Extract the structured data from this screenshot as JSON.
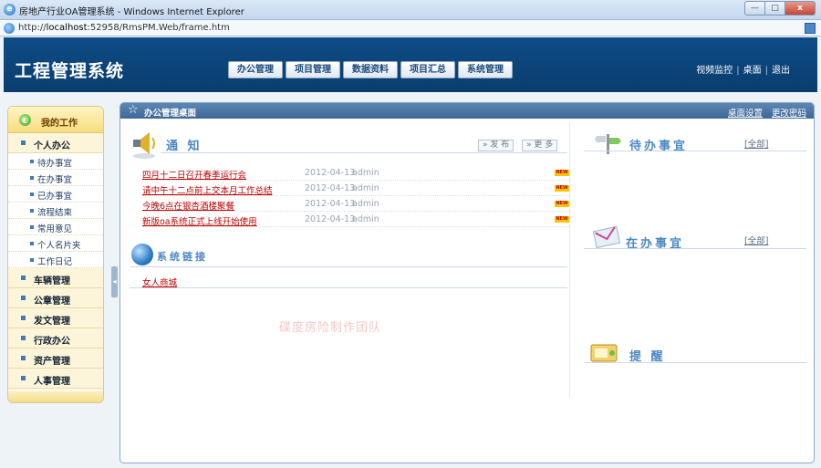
{
  "browser": {
    "window_title": "房地产行业OA管理系统 - Windows Internet Explorer",
    "url_prefix": "http://",
    "url_host": "localhost",
    "url_rest": ":52958/RmsPM.Web/frame.htm",
    "min_label": "—",
    "max_label": "□",
    "close_label": "x"
  },
  "header": {
    "logo": "工程管理系统",
    "nav": [
      "办公管理",
      "项目管理",
      "数据资料",
      "项目汇总",
      "系统管理"
    ],
    "links": [
      "视频监控",
      "桌面",
      "退出"
    ],
    "separator": "|"
  },
  "sidebar": {
    "title": "我的工作",
    "groups": [
      {
        "label": "个人办公",
        "items": [
          "待办事宜",
          "在办事宜",
          "已办事宜",
          "流程结束",
          "常用意见",
          "个人名片夹",
          "工作日记"
        ]
      },
      {
        "label": "车辆管理",
        "items": []
      },
      {
        "label": "公章管理",
        "items": []
      },
      {
        "label": "发文管理",
        "items": []
      },
      {
        "label": "行政办公",
        "items": []
      },
      {
        "label": "资产管理",
        "items": []
      },
      {
        "label": "人事管理",
        "items": []
      }
    ],
    "collapse_glyph": "◂"
  },
  "main": {
    "title": "办公管理桌面",
    "links": [
      "桌面设置",
      "更改密码"
    ],
    "notice": {
      "title": "通 知",
      "buttons": [
        "» 发 布",
        "» 更 多"
      ],
      "badge": "NEW",
      "items": [
        {
          "title": "四月十二日召开春季运行会",
          "date": "2012-04-13",
          "author": "admin"
        },
        {
          "title": "请中午十二点前上交本月工作总结",
          "date": "2012-04-13",
          "author": "admin"
        },
        {
          "title": "今晚6点在银杏酒楼聚餐",
          "date": "2012-04-13",
          "author": "admin"
        },
        {
          "title": "新版oa系统正式上线开始使用",
          "date": "2012-04-13",
          "author": "admin"
        }
      ]
    },
    "system_links": {
      "title": "系统链接",
      "items": [
        "女人商城"
      ]
    },
    "watermark": "碟度房险制作团队",
    "todo": {
      "title": "待办事宜",
      "all": "[全部]"
    },
    "in_progress": {
      "title": "在办事宜",
      "all": "[全部]"
    },
    "reminder": {
      "title": "提 醒"
    }
  },
  "colors": {
    "header_blue": "#0a3d6e",
    "accent_blue": "#4c88c4",
    "link_red": "#c00000",
    "sidebar_bg": "#fdf9e8"
  }
}
